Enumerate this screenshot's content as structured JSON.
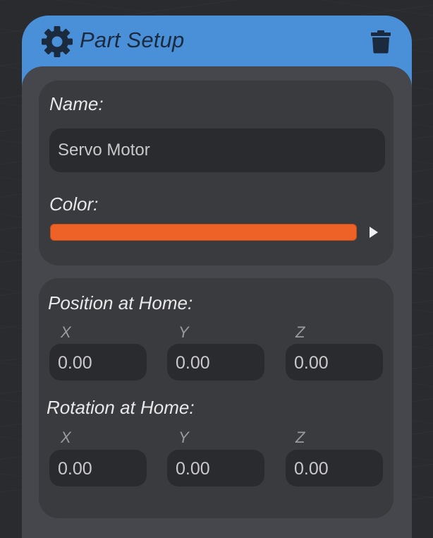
{
  "header": {
    "title": "Part Setup",
    "accent_color": "#4a90d9",
    "icons": [
      "gear-icon",
      "trash-icon"
    ]
  },
  "name_section": {
    "label": "Name:",
    "value": "Servo Motor"
  },
  "color_section": {
    "label": "Color:",
    "swatch_color": "#ee6227",
    "expand_icon": "play-icon"
  },
  "position": {
    "label": "Position at Home:",
    "axes": [
      {
        "label": "X",
        "value": "0.00"
      },
      {
        "label": "Y",
        "value": "0.00"
      },
      {
        "label": "Z",
        "value": "0.00"
      }
    ]
  },
  "rotation": {
    "label": "Rotation at Home:",
    "axes": [
      {
        "label": "X",
        "value": "0.00"
      },
      {
        "label": "Y",
        "value": "0.00"
      },
      {
        "label": "Z",
        "value": "0.00"
      }
    ]
  }
}
